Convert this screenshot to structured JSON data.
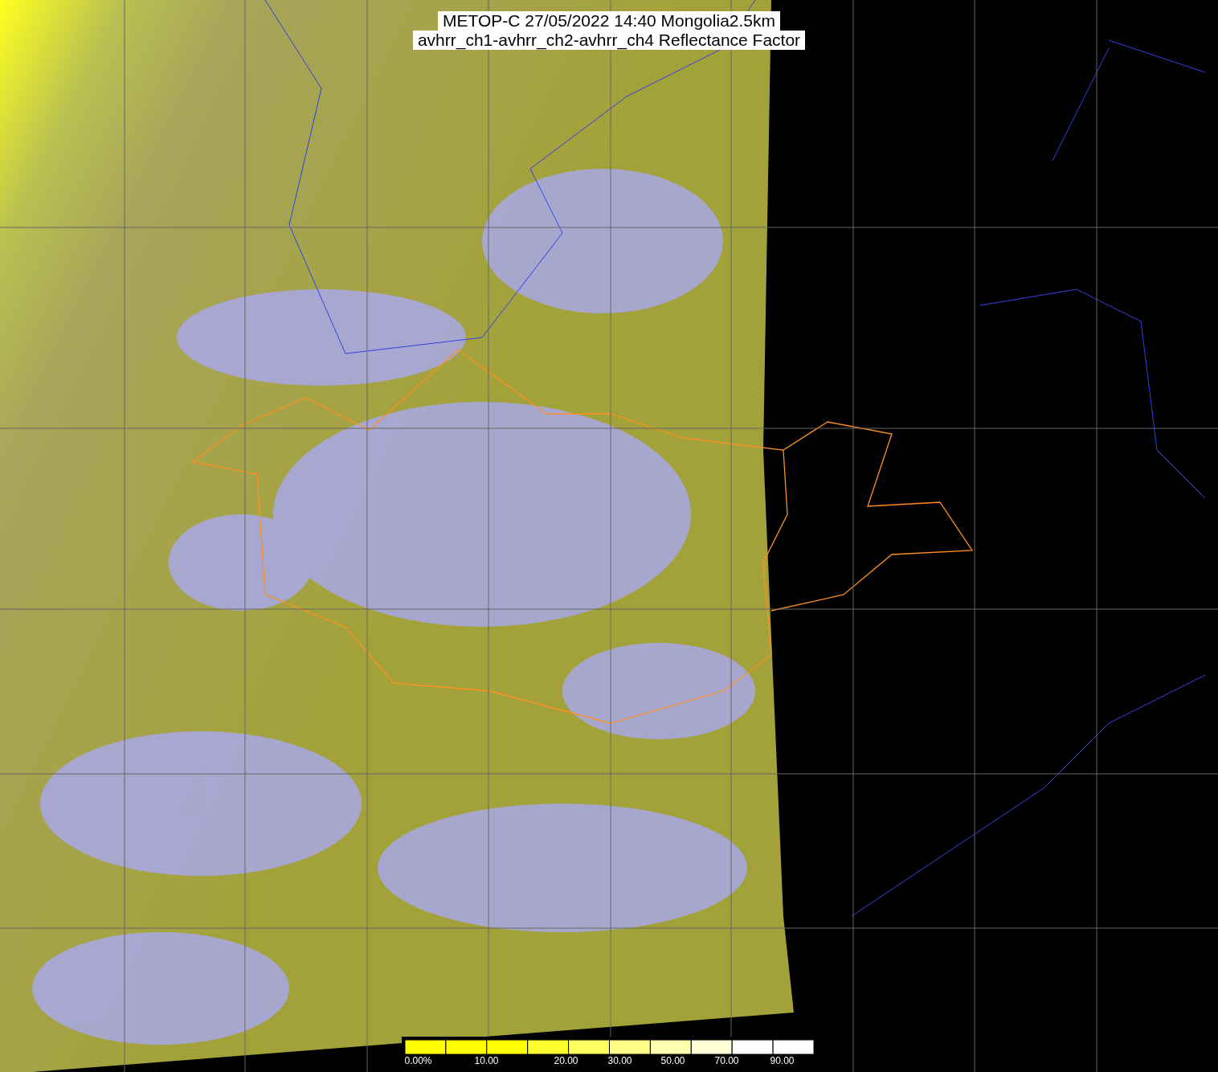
{
  "title": {
    "lines": [
      "METOP-C 27/05/2022 14:40 Mongolia2.5km",
      "avhrr_ch1-avhrr_ch2-avhrr_ch4 Reflectance Factor"
    ]
  },
  "colorbar": {
    "labels": [
      "0.00%",
      "10.00",
      "20.00",
      "30.00",
      "50.00",
      "70.00",
      "90.00"
    ]
  }
}
